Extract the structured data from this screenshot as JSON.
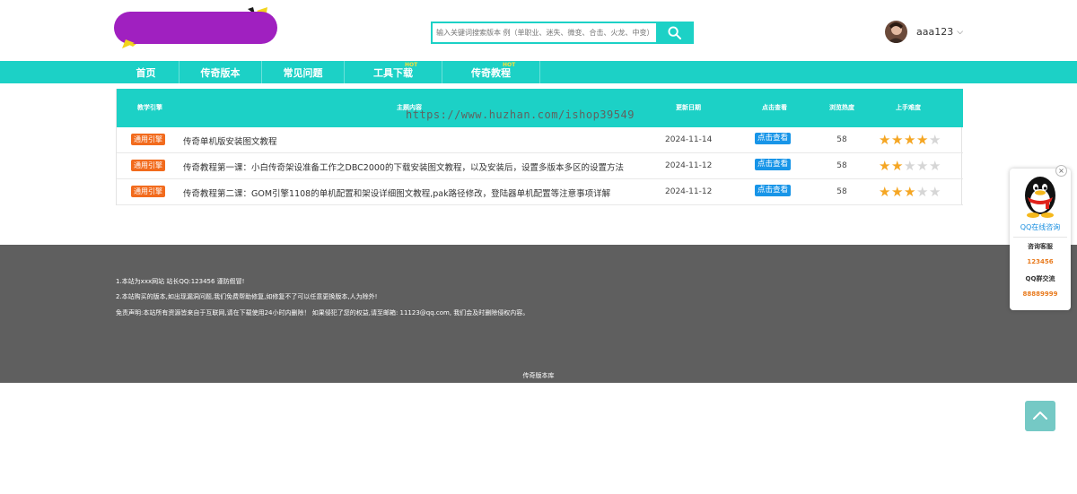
{
  "search": {
    "placeholder": "输入关键词搜索版本 例（单职业、迷失、微变、合击、火龙、中变）"
  },
  "user": {
    "name": "aaa123"
  },
  "nav": [
    {
      "label": "首页",
      "hot": ""
    },
    {
      "label": "传奇版本",
      "hot": ""
    },
    {
      "label": "常见问题",
      "hot": ""
    },
    {
      "label": "工具下载",
      "hot": "HOT"
    },
    {
      "label": "传奇教程",
      "hot": "HOT"
    }
  ],
  "table": {
    "headers": [
      "教学引擎",
      "主题内容",
      "更新日期",
      "点击查看",
      "浏览热度",
      "上手难度"
    ],
    "watermark": "https://www.huzhan.com/ishop39549",
    "rows": [
      {
        "badge": "通用引擎",
        "title": "传奇单机版安装图文教程",
        "date": "2024-11-14",
        "view": "点击查看",
        "count": "58",
        "rating": 4
      },
      {
        "badge": "通用引擎",
        "title": "传奇教程第一课：小白传奇架设准备工作之DBC2000的下载安装图文教程，以及安装后，设置多版本多区的设置方法",
        "date": "2024-11-12",
        "view": "点击查看",
        "count": "58",
        "rating": 2
      },
      {
        "badge": "通用引擎",
        "title": "传奇教程第二课：GOM引擎1108的单机配置和架设详细图文教程,pak路径修改，登陆器单机配置等注意事项详解",
        "date": "2024-11-12",
        "view": "点击查看",
        "count": "58",
        "rating": 3
      }
    ]
  },
  "footer": {
    "lines": [
      "1.本站为xxx网站 站长QQ:123456 谨防假冒!",
      "2.本站购买的版本,如出现漏洞问题,我们免费帮助修复,如修复不了可以任意更换版本,人为除外!",
      "免责声明:本站所有资源皆来自于互联网,请在下载使用24小时内删除！ 如果侵犯了您的权益,请至邮箱: 11123@qq.com, 我们会及时删除侵权内容。"
    ],
    "copyright": "传奇版本库"
  },
  "qq_widget": {
    "close": "×",
    "online": "QQ在线咨询",
    "service_label": "咨询客服",
    "service_qq": "123456",
    "group_label": "QQ群交流",
    "group_qq": "88889999"
  },
  "colors": {
    "accent": "#1cd1c6",
    "badge": "#f26b1d",
    "view_button": "#1895e8",
    "star_on": "#f5a623",
    "star_off": "#d6d6d6",
    "footer": "#5f5f5f"
  },
  "icons": {
    "search": "search-icon",
    "chevron": "chevron-down-icon",
    "back_to_top": "chevron-up-icon"
  }
}
